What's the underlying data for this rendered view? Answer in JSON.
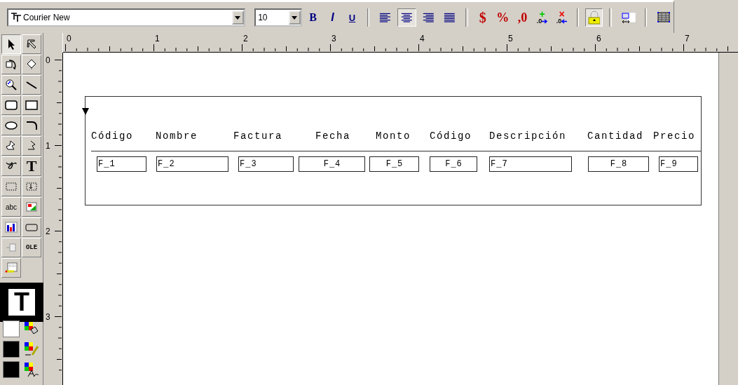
{
  "toolbar": {
    "font": {
      "value": "Courier New"
    },
    "size": {
      "value": "10"
    },
    "style_buttons": [
      {
        "label": "B",
        "kind": "bold"
      },
      {
        "label": "I",
        "kind": "italic"
      },
      {
        "label": "U",
        "kind": "underline"
      }
    ],
    "align_buttons": [
      {
        "kind": "left",
        "selected": false
      },
      {
        "kind": "center",
        "selected": true
      },
      {
        "kind": "right",
        "selected": false
      },
      {
        "kind": "justify",
        "selected": false
      }
    ],
    "number_buttons": [
      {
        "label": "$",
        "kind": "currency"
      },
      {
        "label": "%",
        "kind": "percent"
      },
      {
        "label": ",0",
        "kind": "thousands"
      },
      {
        "label": ".0",
        "sign": "+",
        "kind": "add-decimal"
      },
      {
        "label": ".0",
        "sign": "×",
        "kind": "remove-decimal"
      }
    ],
    "lock": {
      "selected": true
    }
  },
  "palette": {
    "tools": [
      {
        "kind": "pointer",
        "selected": true
      },
      {
        "kind": "select-arrow",
        "selected": false
      },
      {
        "kind": "rotate",
        "selected": false
      },
      {
        "kind": "node",
        "selected": false
      },
      {
        "kind": "zoom",
        "selected": false
      },
      {
        "kind": "line",
        "selected": false
      },
      {
        "kind": "rounded-rect",
        "selected": false
      },
      {
        "kind": "rect",
        "selected": false
      },
      {
        "kind": "ellipse",
        "selected": false
      },
      {
        "kind": "arc",
        "selected": false
      },
      {
        "kind": "polygon",
        "selected": false
      },
      {
        "kind": "polyline",
        "selected": false
      },
      {
        "kind": "freehand",
        "selected": false
      },
      {
        "kind": "text",
        "label": "T",
        "selected": false
      },
      {
        "kind": "frame",
        "selected": false
      },
      {
        "kind": "frame-arrow",
        "selected": false
      },
      {
        "kind": "field",
        "label": "abc",
        "selected": false
      },
      {
        "kind": "image",
        "selected": false
      },
      {
        "kind": "chart",
        "selected": false
      },
      {
        "kind": "button",
        "selected": false
      },
      {
        "kind": "check",
        "selected": false
      },
      {
        "kind": "ole",
        "label": "OLE",
        "selected": false
      },
      {
        "kind": "barcode",
        "selected": false
      }
    ],
    "preview": "T"
  },
  "rulers": {
    "horizontal": [
      "0",
      "1",
      "2",
      "3",
      "4",
      "5",
      "6",
      "7"
    ],
    "vertical": [
      "0",
      "1",
      "2",
      "3"
    ]
  },
  "band": {
    "labels": [
      "Código",
      "Nombre",
      "Factura",
      "Fecha",
      "Monto",
      "Código",
      "Descripción",
      "Cantidad",
      "Precio"
    ],
    "fields": [
      {
        "text": "F_1",
        "centered": false
      },
      {
        "text": "F_2",
        "centered": false
      },
      {
        "text": "F_3",
        "centered": false
      },
      {
        "text": "F_4",
        "centered": true
      },
      {
        "text": "F_5",
        "centered": true
      },
      {
        "text": "F_6",
        "centered": true
      },
      {
        "text": "F_7",
        "centered": false
      },
      {
        "text": "F_8",
        "centered": true
      },
      {
        "text": "F_9",
        "centered": false
      }
    ]
  }
}
